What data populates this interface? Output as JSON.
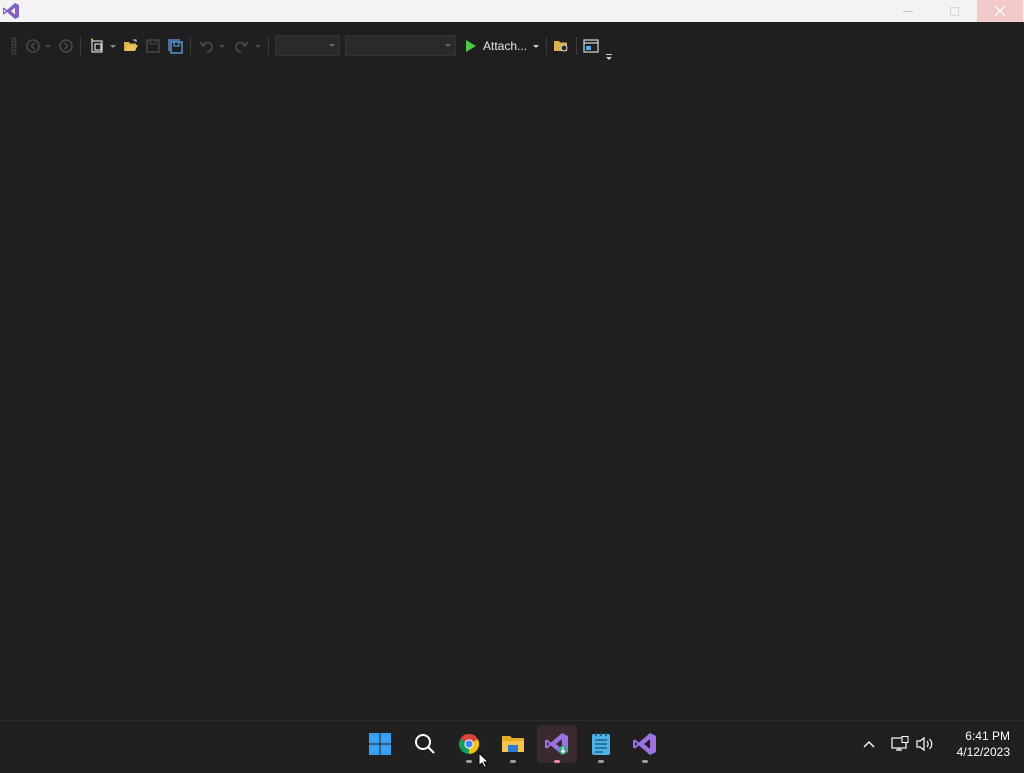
{
  "titlebar": {
    "app_icon": "visual-studio-icon",
    "controls": [
      "minimize-icon",
      "maximize-icon",
      "close-icon"
    ]
  },
  "toolbar": {
    "start_label": "Attach...",
    "icons": [
      "back-icon",
      "forward-icon",
      "new-project-icon",
      "open-folder-icon",
      "save-icon",
      "save-all-icon",
      "undo-icon",
      "redo-icon",
      "play-icon",
      "browser-folder-icon",
      "window-layout-icon"
    ],
    "config_combo_value": "",
    "platform_combo_value": ""
  },
  "taskbar": {
    "apps": [
      "windows-start-icon",
      "search-icon",
      "chrome-icon",
      "file-explorer-icon",
      "visual-studio-installer-icon",
      "notepad-icon",
      "visual-studio-icon"
    ],
    "active_app": "visual-studio-installer-icon"
  },
  "tray": {
    "icons": [
      "chevron-up-icon",
      "network-icon",
      "volume-icon"
    ]
  },
  "clock": {
    "time": "6:41 PM",
    "date": "4/12/2023"
  },
  "colors": {
    "background": "#1f1f1f",
    "titlebar": "#f3f3f3",
    "taskbar": "#202020",
    "vs_purple": "#8661c5",
    "play_green": "#4ec943"
  }
}
